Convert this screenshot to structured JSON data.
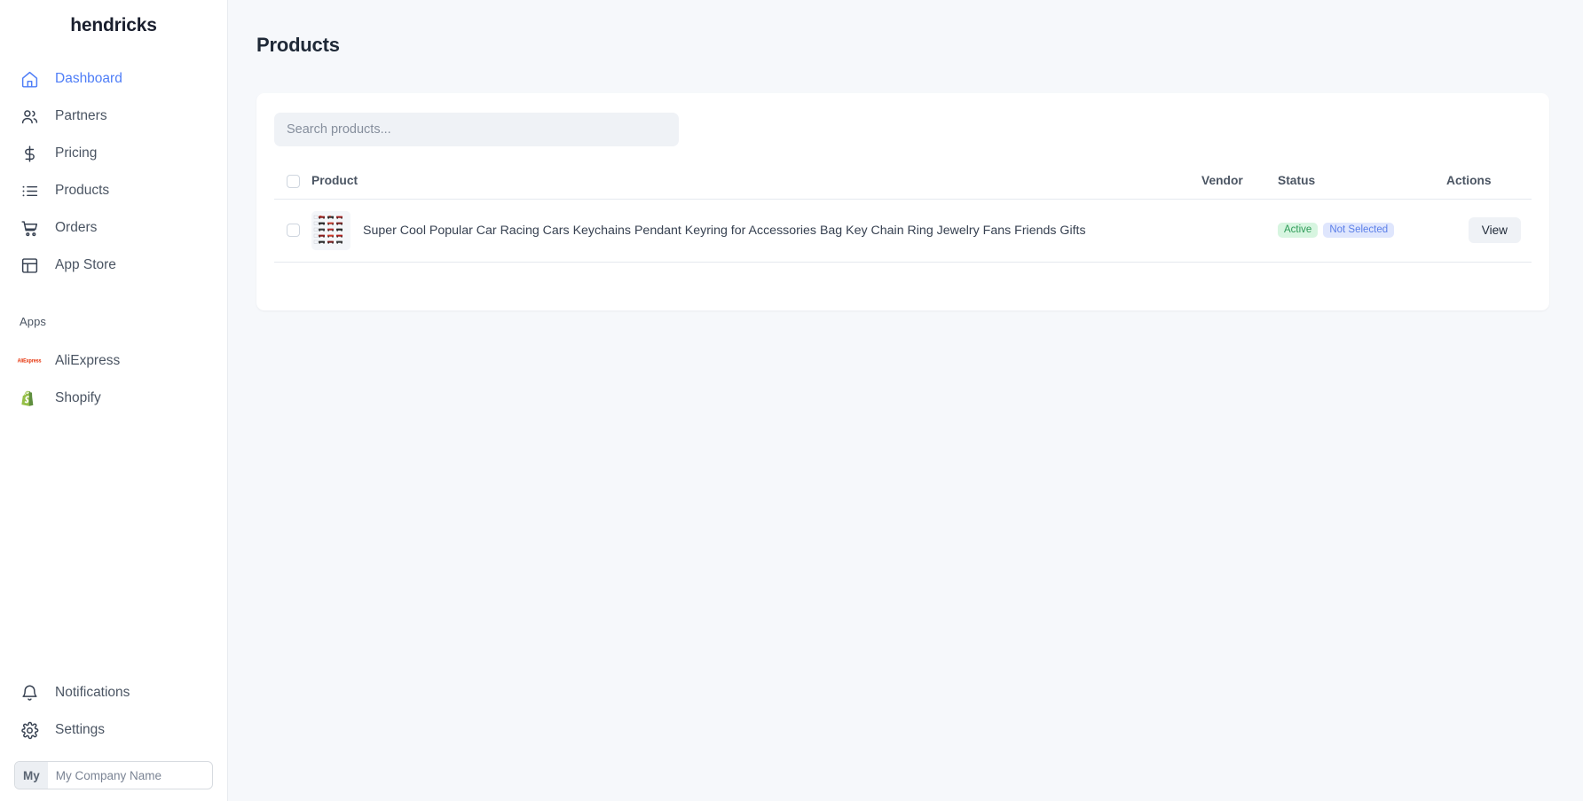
{
  "brand": {
    "name": "hendricks"
  },
  "sidebar": {
    "nav": [
      {
        "label": "Dashboard",
        "icon": "home-icon",
        "active": true
      },
      {
        "label": "Partners",
        "icon": "users-icon",
        "active": false
      },
      {
        "label": "Pricing",
        "icon": "dollar-icon",
        "active": false
      },
      {
        "label": "Products",
        "icon": "list-icon",
        "active": false
      },
      {
        "label": "Orders",
        "icon": "cart-icon",
        "active": false
      },
      {
        "label": "App Store",
        "icon": "layout-icon",
        "active": false
      }
    ],
    "apps_section_label": "Apps",
    "apps": [
      {
        "label": "AliExpress",
        "icon": "aliexpress-logo",
        "logo_text": "AliExpress"
      },
      {
        "label": "Shopify",
        "icon": "shopify-logo"
      }
    ],
    "bottom": [
      {
        "label": "Notifications",
        "icon": "bell-icon"
      },
      {
        "label": "Settings",
        "icon": "gear-icon"
      }
    ],
    "company": {
      "prefix": "My",
      "value": "",
      "placeholder": "My Company Name"
    }
  },
  "main": {
    "page_title": "Products",
    "search": {
      "value": "",
      "placeholder": "Search products..."
    },
    "table": {
      "headers": {
        "product": "Product",
        "vendor": "Vendor",
        "status": "Status",
        "actions": "Actions"
      },
      "rows": [
        {
          "name": "Super Cool Popular Car Racing Cars Keychains Pendant Keyring for Accessories Bag Key Chain Ring Jewelry Fans Friends Gifts",
          "vendor": "",
          "badges": [
            {
              "text": "Active",
              "type": "active"
            },
            {
              "text": "Not Selected",
              "type": "notselected"
            }
          ],
          "action_label": "View"
        }
      ]
    }
  },
  "colors": {
    "accent": "#4f7ef7",
    "page_bg": "#f6f8fb",
    "card_bg": "#ffffff",
    "badge_active_bg": "#d7f5e0",
    "badge_active_fg": "#2e9b58",
    "badge_notselected_bg": "#dfe6fd",
    "badge_notselected_fg": "#5b7fe8"
  }
}
